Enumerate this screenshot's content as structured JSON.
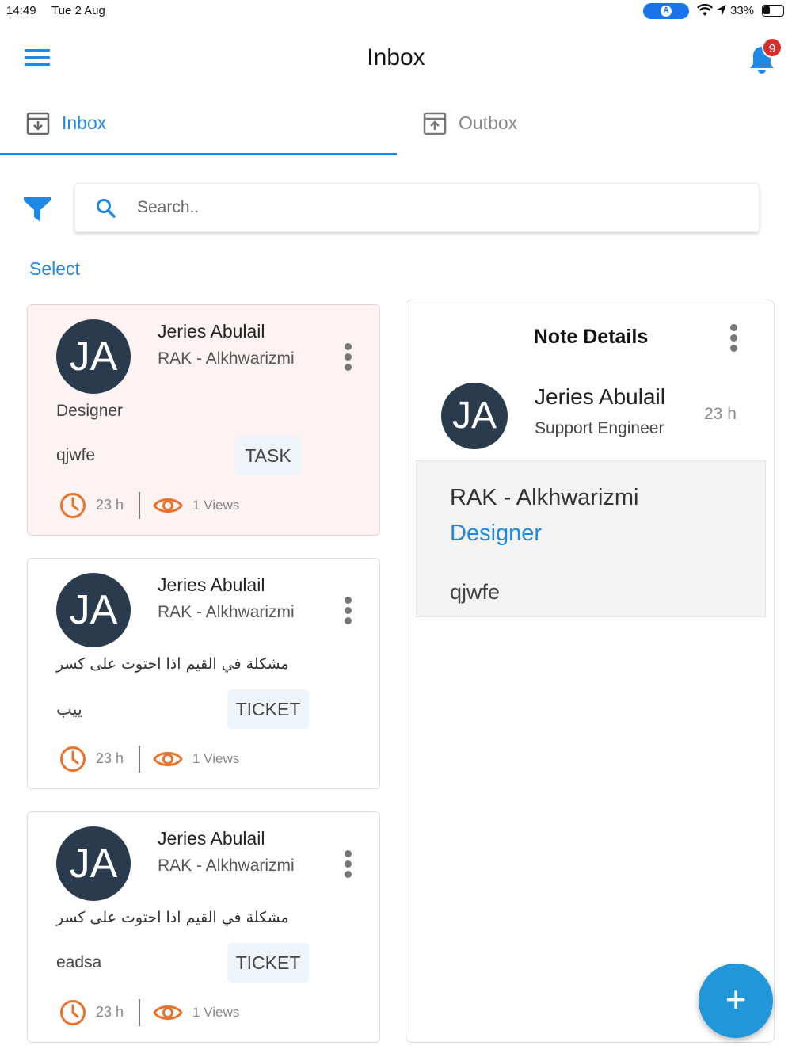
{
  "status_bar": {
    "time": "14:49",
    "date": "Tue 2 Aug",
    "battery": "33%"
  },
  "header": {
    "title": "Inbox",
    "notification_count": "9"
  },
  "tabs": [
    {
      "label": "Inbox",
      "active": true
    },
    {
      "label": "Outbox",
      "active": false
    }
  ],
  "search": {
    "placeholder": "Search.."
  },
  "select_label": "Select",
  "cards": [
    {
      "initials": "JA",
      "name": "Jeries Abulail",
      "org": "RAK - Alkhwarizmi",
      "subtitle": "Designer",
      "body": "qjwfe",
      "tag": "TASK",
      "time": "23 h",
      "views": "1 Views"
    },
    {
      "initials": "JA",
      "name": "Jeries Abulail",
      "org": "RAK - Alkhwarizmi",
      "subtitle": "مشكلة في القيم اذا احتوت على كسر",
      "body": "ييب",
      "tag": "TICKET",
      "time": "23 h",
      "views": "1 Views"
    },
    {
      "initials": "JA",
      "name": "Jeries Abulail",
      "org": "RAK - Alkhwarizmi",
      "subtitle": "مشكلة في القيم اذا احتوت على كسر",
      "body": "eadsa",
      "tag": "TICKET",
      "time": "23 h",
      "views": "1 Views"
    }
  ],
  "detail": {
    "title": "Note Details",
    "initials": "JA",
    "name": "Jeries Abulail",
    "position": "Support Engineer",
    "time": "23 h",
    "org": "RAK - Alkhwarizmi",
    "role": "Designer",
    "body": "qjwfe"
  },
  "fab_label": "+",
  "colors": {
    "accent": "#1e88e5",
    "avatar": "#2b3b4e",
    "orange": "#e8732c",
    "badge": "#d32f2f",
    "selected_card": "#fdf3f3"
  },
  "icons": [
    "menu-icon",
    "bell-icon",
    "inbox-tray-icon",
    "outbox-tray-icon",
    "filter-icon",
    "search-icon",
    "more-vert-icon",
    "clock-icon",
    "eye-icon",
    "plus-icon"
  ]
}
